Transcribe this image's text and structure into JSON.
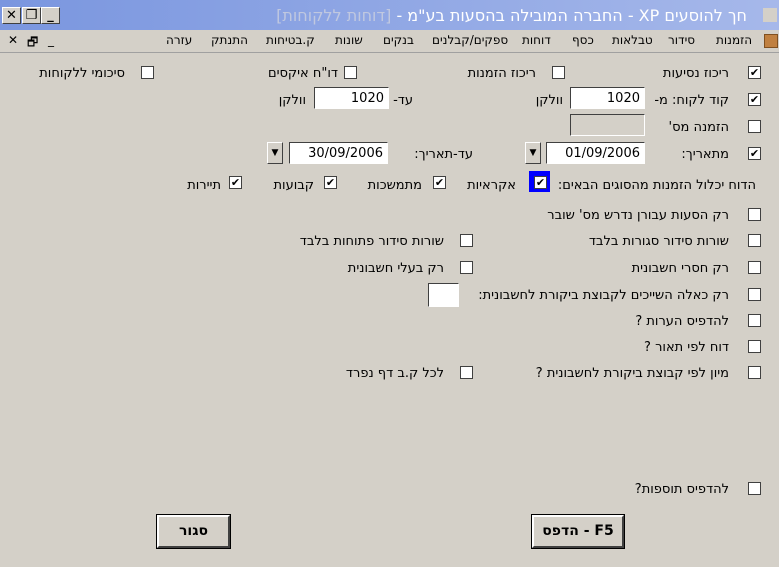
{
  "window": {
    "title_main": "חך להוסעים XP - החברה המובילה בהסעות בע\"מ - ",
    "title_bracket": "[דוחות ללקוחות]",
    "close_label": "✕",
    "restore_label": "❐",
    "minimize_label": "_",
    "mdi_close": "✕",
    "mdi_restore": "🗗",
    "mdi_min": "_"
  },
  "menu": [
    "הזמנות",
    "סידור",
    "טבלאות",
    "כסף",
    "דוחות",
    "ספקים/קבלנים",
    "בנקים",
    "שונות",
    "ק.בטיחות",
    "התנתק",
    "עזרה"
  ],
  "form": {
    "rikuz_nesiot": "ריכוז נסיעות",
    "rikuz_hazmanot": "ריכוז הזמנות",
    "doch_excel": "דו\"ח איקסים",
    "sikumei": "סיכומי ללקוחות",
    "customer_code_label": "קוד לקוח: מ-",
    "customer_from_value": "1020",
    "customer_from_name": "וולקן",
    "to_label": "עד-",
    "customer_to_value": "1020",
    "customer_to_name": "וולקן",
    "order_no_label": "הזמנה מס'",
    "from_date_label": "מתאריך:",
    "from_date": "01/09/2006",
    "to_date_label": "עד-תאריך:",
    "to_date": "30/09/2006",
    "report_includes_label": "הדוח יכלול הזמנות מהסוגים הבאים:",
    "types": [
      "אקראיות",
      "מתמשכות",
      "קבועות",
      "תיירות"
    ],
    "opt_overtime": "רק הסעות עבורן נדרש מס' שובר",
    "opt_closed_lines": "שורות סידור סגורות בלבד",
    "opt_open_lines": "שורות סידור פתוחות בלבד",
    "opt_no_invoices": "רק חסרי חשבונית",
    "opt_with_invoices": "רק בעלי חשבונית",
    "opt_group": "רק כאלה השייכים לקבוצת ביקורת לחשבונית:",
    "opt_print_notes": "להדפיס הערות ?",
    "opt_by_desc": "דוח לפי תאור ?",
    "opt_sort_group": "מיון לפי קבוצת ביקורת לחשבונית ?",
    "opt_each_page": "לכל ק.ב דף נפרד",
    "opt_print_extras": "להדפיס תוספות?",
    "print_button": "הדפס - F5",
    "close_button": "סגור"
  }
}
